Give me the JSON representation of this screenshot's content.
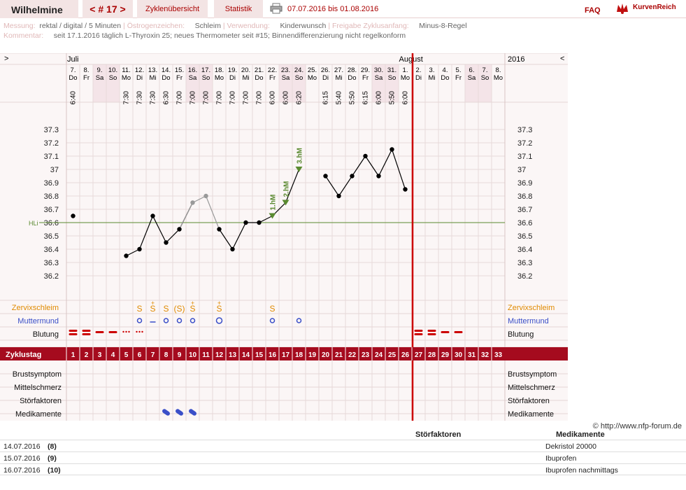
{
  "header": {
    "name": "Wilhelmine",
    "cycle_nav": "< # 17 >",
    "links": [
      "Zyklenübersicht",
      "Statistik"
    ],
    "date_range": "07.07.2016 bis 01.08.2016",
    "faq": "FAQ",
    "brand": "KurvenReich"
  },
  "info": {
    "row1": [
      {
        "label": "Messung:",
        "value": "rektal / digital / 5 Minuten"
      },
      {
        "label": "Östrogenzeichen:",
        "value": "Schleim"
      },
      {
        "label": "Verwendung:",
        "value": "Kinderwunsch"
      },
      {
        "label": "Freigabe Zyklusanfang:",
        "value": "Minus-8-Regel"
      }
    ],
    "row2": {
      "label": "Kommentar:",
      "value": "seit 17.1.2016 täglich L-Thyroxin 25; neues Thermometer seit #15; Binnendifferenzierung nicht regelkonform"
    }
  },
  "chart_data": {
    "type": "line",
    "months": {
      "left": "Juli",
      "center": "August",
      "year": "2016",
      "nav_left": ">",
      "nav_right": "<"
    },
    "dates": [
      "7.",
      "8.",
      "9.",
      "10.",
      "11.",
      "12.",
      "13.",
      "14.",
      "15.",
      "16.",
      "17.",
      "18.",
      "19.",
      "20.",
      "21.",
      "22.",
      "23.",
      "24.",
      "25.",
      "26.",
      "27.",
      "28.",
      "29.",
      "30.",
      "31.",
      "1.",
      "2.",
      "3.",
      "4.",
      "5.",
      "6.",
      "7.",
      "8."
    ],
    "weekdays": [
      "Do",
      "Fr",
      "Sa",
      "So",
      "Mo",
      "Di",
      "Mi",
      "Do",
      "Fr",
      "Sa",
      "So",
      "Mo",
      "Di",
      "Mi",
      "Do",
      "Fr",
      "Sa",
      "So",
      "Mo",
      "Di",
      "Mi",
      "Do",
      "Fr",
      "Sa",
      "So",
      "Mo",
      "Di",
      "Mi",
      "Do",
      "Fr",
      "Sa",
      "So",
      "Mo"
    ],
    "weekend": [
      false,
      false,
      true,
      true,
      false,
      false,
      false,
      false,
      false,
      true,
      true,
      false,
      false,
      false,
      false,
      false,
      true,
      true,
      false,
      false,
      false,
      false,
      false,
      true,
      true,
      false,
      false,
      false,
      false,
      false,
      true,
      true,
      false
    ],
    "times": [
      "6:40",
      "",
      "",
      "",
      "7:30",
      "7:30",
      "7:30",
      "6:30",
      "7:00",
      "7:00",
      "7:00",
      "7:00",
      "7:00",
      "7:00",
      "7:00",
      "6:00",
      "6:00",
      "6:20",
      "",
      "6:15",
      "5:40",
      "5:50",
      "6:15",
      "6:00",
      "5:50",
      "6:00",
      "",
      "",
      "",
      "",
      "",
      "",
      ""
    ],
    "cycle_days": [
      "1",
      "2",
      "3",
      "4",
      "5",
      "6",
      "7",
      "8",
      "9",
      "10",
      "11",
      "12",
      "13",
      "14",
      "15",
      "16",
      "17",
      "18",
      "19",
      "20",
      "21",
      "22",
      "23",
      "24",
      "25",
      "26",
      "27",
      "28",
      "29",
      "30",
      "31",
      "32",
      "33"
    ],
    "cycle_label": "Zyklustag",
    "temperatures": [
      36.65,
      null,
      null,
      null,
      36.35,
      36.4,
      36.65,
      36.45,
      36.55,
      36.75,
      36.8,
      36.55,
      36.4,
      36.6,
      36.6,
      36.65,
      36.75,
      37.0,
      null,
      36.95,
      36.8,
      36.95,
      37.1,
      36.95,
      37.15,
      36.85,
      null,
      null,
      null,
      null,
      null,
      null,
      null
    ],
    "disturbed": [
      false,
      false,
      false,
      false,
      false,
      false,
      false,
      false,
      false,
      true,
      true,
      false,
      false,
      false,
      false,
      false,
      false,
      false,
      false,
      false,
      false,
      false,
      false,
      false,
      false,
      false,
      false,
      false,
      false,
      false,
      false,
      false,
      false
    ],
    "segments": [
      [
        4,
        5,
        6,
        7,
        8,
        9
      ],
      [
        9,
        10
      ],
      [
        11,
        12,
        13,
        14,
        15,
        16,
        17
      ],
      [
        19,
        20,
        21,
        22,
        23,
        24,
        25
      ]
    ],
    "y_ticks": [
      "37.3",
      "37.2",
      "37.1",
      "37",
      "36.9",
      "36.8",
      "36.7",
      "36.6",
      "36.5",
      "36.4",
      "36.3",
      "36.2"
    ],
    "ylim": [
      36.1,
      37.4
    ],
    "coverline": 36.6,
    "coverline_label": "HLi",
    "markers": [
      {
        "day_index": 15,
        "label": "1.hM"
      },
      {
        "day_index": 16,
        "label": "2.hM"
      },
      {
        "day_index": 17,
        "label": "3.hM"
      }
    ],
    "cycle_end_index": 26,
    "rows": {
      "cervical": {
        "label": "Zervixschleim",
        "values": [
          "",
          "",
          "",
          "",
          "",
          "S",
          "S+",
          "S",
          "(S)",
          "S+",
          "",
          "S+",
          "",
          "",
          "",
          "S",
          "",
          "",
          "",
          "",
          "",
          "",
          "",
          "",
          "",
          "",
          "",
          "",
          "",
          "",
          "",
          "",
          ""
        ]
      },
      "cervix": {
        "label": "Muttermund",
        "values": [
          "",
          "",
          "",
          "",
          "",
          "o",
          "-",
          "o",
          "o",
          "o",
          "",
          "O",
          "",
          "",
          "",
          "o",
          "",
          "o",
          "",
          "",
          "",
          "",
          "",
          "",
          "",
          "",
          "",
          "",
          "",
          "",
          "",
          "",
          ""
        ]
      },
      "bleeding": {
        "label": "Blutung",
        "values": [
          "heavy",
          "heavy",
          "light",
          "light",
          "spot",
          "spot",
          "",
          "",
          "",
          "",
          "",
          "",
          "",
          "",
          "",
          "",
          "",
          "",
          "",
          "",
          "",
          "",
          "",
          "",
          "",
          "",
          "heavy",
          "heavy",
          "light",
          "light",
          "",
          "",
          ""
        ]
      },
      "breast": {
        "label": "Brustsymptom"
      },
      "midpain": {
        "label": "Mittelschmerz"
      },
      "disturbances": {
        "label": "Störfaktoren"
      },
      "medication": {
        "label": "Medikamente",
        "pill_days": [
          7,
          8,
          9
        ]
      }
    }
  },
  "footer": {
    "credit": "© http://www.nfp-forum.de",
    "col_headers": [
      "Störfaktoren",
      "Medikamente"
    ],
    "rows": [
      {
        "date": "14.07.2016",
        "day": "(8)",
        "medication": "Dekristol 20000"
      },
      {
        "date": "15.07.2016",
        "day": "(9)",
        "medication": "Ibuprofen"
      },
      {
        "date": "16.07.2016",
        "day": "(10)",
        "medication": "Ibuprofen nachmittags"
      }
    ]
  },
  "colors": {
    "accent": "#a50b1e",
    "orange": "#e08a00",
    "blue": "#3a4fc8",
    "green": "#5a8a30",
    "grid": "#e7dada",
    "weekend": "#f4e4e8"
  }
}
